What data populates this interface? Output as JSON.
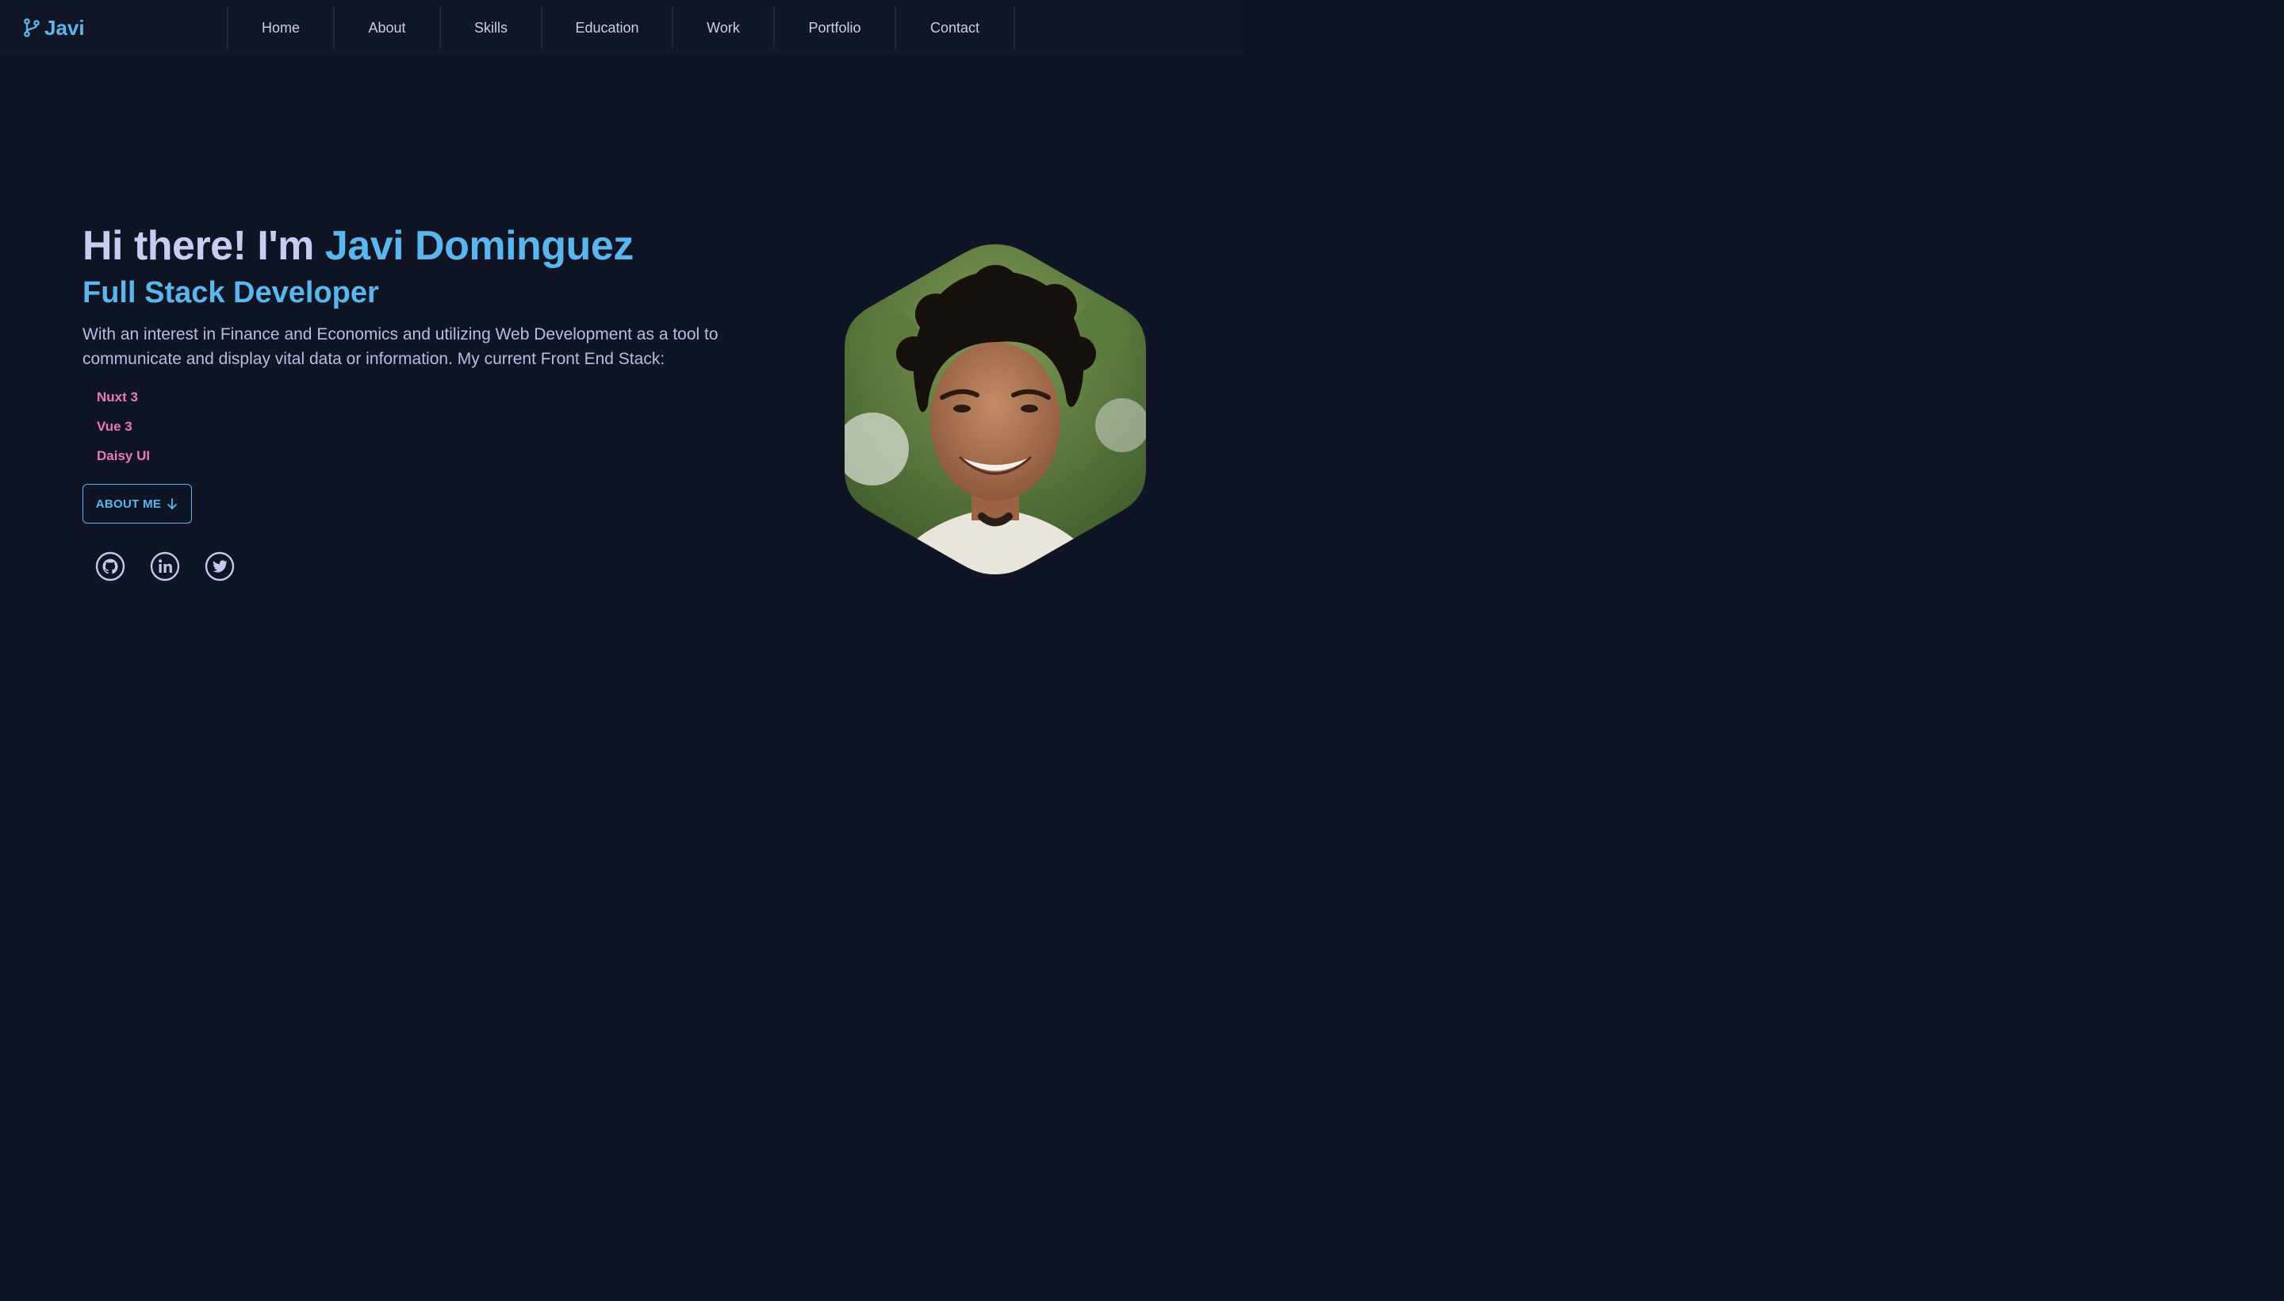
{
  "nav": {
    "brand": "Javi",
    "brand_icon": "git-branch-icon",
    "items": [
      {
        "label": "Home"
      },
      {
        "label": "About"
      },
      {
        "label": "Skills"
      },
      {
        "label": "Education"
      },
      {
        "label": "Work"
      },
      {
        "label": "Portfolio"
      },
      {
        "label": "Contact"
      }
    ]
  },
  "hero": {
    "greeting": "Hi there! I'm ",
    "name": "Javi Dominguez",
    "role": "Full Stack Developer",
    "description": "With an interest in Finance and Economics and utilizing Web Development as a tool to communicate and display vital data or information. My current Front End Stack:",
    "stack": [
      "Nuxt 3",
      "Vue 3",
      "Daisy UI"
    ],
    "button": "ABOUT ME",
    "button_icon": "arrow-down-icon",
    "socials": [
      {
        "icon": "github-icon"
      },
      {
        "icon": "linkedin-icon"
      },
      {
        "icon": "twitter-icon"
      }
    ]
  },
  "colors": {
    "background": "#0f1524",
    "navbar": "#111727",
    "accent": "#5cb6ee",
    "pink": "#e87bb0",
    "text": "#b4bfe0"
  }
}
